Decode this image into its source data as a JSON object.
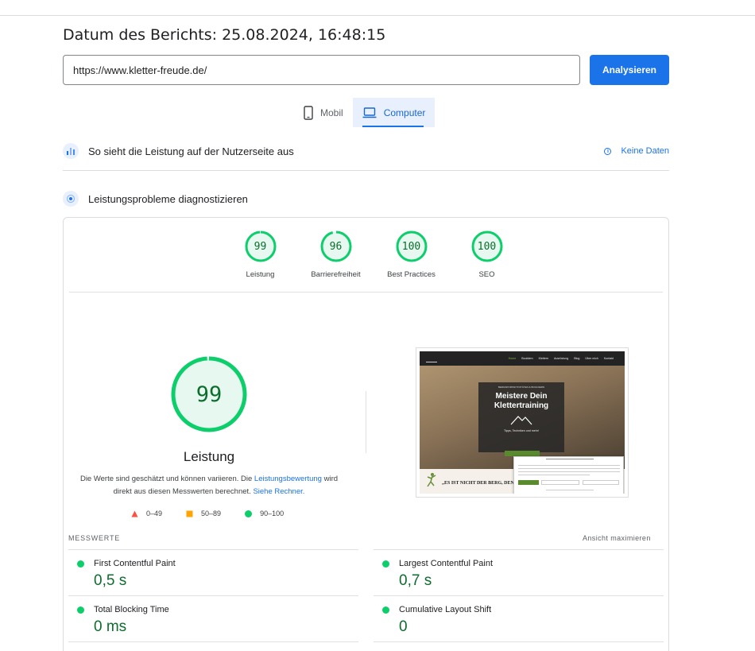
{
  "report": {
    "date_label": "Datum des Berichts: 25.08.2024, 16:48:15"
  },
  "search": {
    "url_value": "https://www.kletter-freude.de/",
    "analyze_label": "Analysieren"
  },
  "tabs": [
    {
      "label": "Mobil",
      "icon": "phone-icon",
      "active": false
    },
    {
      "label": "Computer",
      "icon": "laptop-icon",
      "active": true
    }
  ],
  "field_data": {
    "title": "So sieht die Leistung auf der Nutzerseite aus",
    "no_data_label": "Keine Daten"
  },
  "diagnose": {
    "title": "Leistungsprobleme diagnostizieren"
  },
  "scores": [
    {
      "value": "99",
      "label": "Leistung",
      "fraction": 0.99
    },
    {
      "value": "96",
      "label": "Barrierefreiheit",
      "fraction": 0.96
    },
    {
      "value": "100",
      "label": "Best Practices",
      "fraction": 1.0
    },
    {
      "value": "100",
      "label": "SEO",
      "fraction": 1.0
    }
  ],
  "performance": {
    "score": "99",
    "fraction": 0.99,
    "label": "Leistung",
    "desc_part1": "Die Werte sind geschätzt und können variieren. Die ",
    "desc_link1": "Leistungsbewertung",
    "desc_part2": " wird direkt aus diesen Messwerten berechnet. ",
    "desc_link2": "Siehe Rechner."
  },
  "legend": [
    {
      "range": "0–49",
      "color": "#ff4e42",
      "shape": "triangle"
    },
    {
      "range": "50–89",
      "color": "#ffa400",
      "shape": "square"
    },
    {
      "range": "90–100",
      "color": "#0cce6b",
      "shape": "circle"
    }
  ],
  "screenshot": {
    "nav_items": [
      "Home",
      "Bouldern",
      "Klettern",
      "Ausrüstung",
      "Blog",
      "Über mich",
      "Kontakt"
    ],
    "box_small": "BERGSPORTAKTIVITÄTEN & BOULDERN",
    "box_title_1": "Meistere Dein",
    "box_title_2": "Klettertraining",
    "box_tag": "Tipps, Techniken und mehr!",
    "quote": "„ES IST NICHT DER BERG, DEN W"
  },
  "metrics": {
    "header": "MESSWERTE",
    "maximize_label": "Ansicht maximieren",
    "items": [
      {
        "name": "First Contentful Paint",
        "value": "0,5 s"
      },
      {
        "name": "Largest Contentful Paint",
        "value": "0,7 s"
      },
      {
        "name": "Total Blocking Time",
        "value": "0 ms"
      },
      {
        "name": "Cumulative Layout Shift",
        "value": "0"
      }
    ]
  },
  "colors": {
    "accent": "#1a73e8",
    "pass": "#0cce6b",
    "pass_text": "#0c6d2d",
    "pass_bg": "#e6f8ef"
  }
}
